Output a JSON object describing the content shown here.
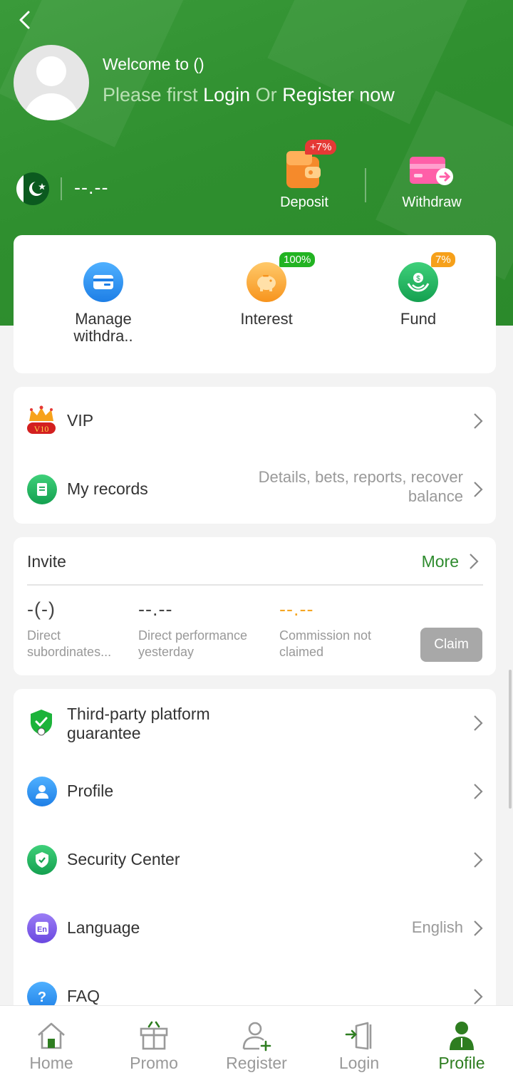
{
  "header": {
    "welcome": "Welcome to ()",
    "login_prefix": "Please first",
    "login_link": "Login",
    "or_text": "Or",
    "register_link": "Register now",
    "balance": "--.--",
    "deposit_label": "Deposit",
    "deposit_badge": "+7%",
    "withdraw_label": "Withdraw"
  },
  "quick_actions": [
    {
      "label_line1": "Manage",
      "label_line2": "withdra..",
      "badge": ""
    },
    {
      "label_line1": "Interest",
      "label_line2": "",
      "badge": "100%"
    },
    {
      "label_line1": "Fund",
      "label_line2": "",
      "badge": "7%"
    }
  ],
  "vip_section": {
    "vip_label": "VIP",
    "vip_level": "V10",
    "records_label": "My records",
    "records_value_line1": "Details, bets, reports, recover",
    "records_value_line2": "balance"
  },
  "invite": {
    "title": "Invite",
    "more": "More",
    "stats": [
      {
        "value": "-(-)",
        "label_line1": "Direct",
        "label_line2": "subordinates..."
      },
      {
        "value": "--.--",
        "label_line1": "Direct performance",
        "label_line2": "yesterday"
      },
      {
        "value": "--.--",
        "label_line1": "Commission not",
        "label_line2": "claimed"
      }
    ],
    "claim_button": "Claim"
  },
  "settings": {
    "guarantee_line1": "Third-party platform",
    "guarantee_line2": "guarantee",
    "profile": "Profile",
    "security": "Security Center",
    "language": "Language",
    "language_value": "English",
    "faq": "FAQ"
  },
  "tabbar": {
    "home": "Home",
    "promo": "Promo",
    "register": "Register",
    "login": "Login",
    "profile": "Profile"
  },
  "colors": {
    "primary_green": "#2e8b2e",
    "active_tab": "#2e7d20",
    "commission_orange": "#f5a623"
  }
}
